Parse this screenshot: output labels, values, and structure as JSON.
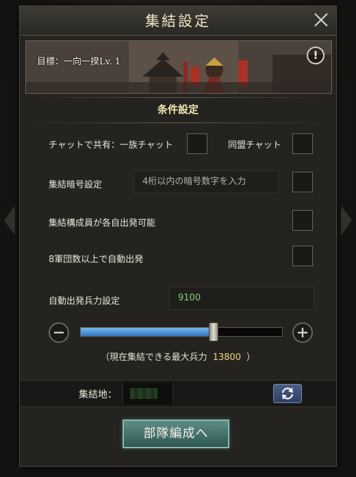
{
  "dialog": {
    "title": "集結設定",
    "target_text": "目標：一向一揆Lv. 1",
    "info_symbol": "!"
  },
  "conditions": {
    "section_title": "条件設定",
    "share_label": "チャットで共有：一族チャット",
    "alliance_chat_label": "同盟チャット",
    "password_label": "集結暗号設定",
    "password_placeholder": "4桁以内の暗号数字を入力",
    "each_depart_label": "集結構成員が各自出発可能",
    "auto_depart_label": "8軍団数以上で自動出発",
    "auto_troops_label": "自動出発兵力設定",
    "auto_troops_value": "9100"
  },
  "slider": {
    "value": 9100,
    "max": 13800,
    "max_prefix": "（現在集結できる最大兵力",
    "max_value": "13800",
    "max_suffix": "）"
  },
  "location": {
    "label": "集結地："
  },
  "actions": {
    "primary_label": "部隊編成へ"
  },
  "colors": {
    "value_green": "#7fd27f",
    "slider_blue": "#4a97dc",
    "gold": "#f0d67c"
  },
  "icons": [
    "close-icon",
    "info-icon",
    "minus-icon",
    "plus-icon",
    "refresh-icon"
  ]
}
